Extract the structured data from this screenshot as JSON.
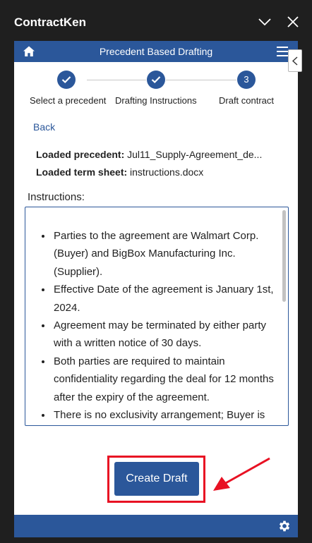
{
  "window": {
    "title": "ContractKen"
  },
  "header": {
    "title": "Precedent Based Drafting"
  },
  "steps": [
    {
      "number": "1",
      "label": "Select a precedent",
      "done": true
    },
    {
      "number": "2",
      "label": "Drafting Instructions",
      "done": true
    },
    {
      "number": "3",
      "label": "Draft contract",
      "done": false
    }
  ],
  "nav": {
    "back_label": "Back"
  },
  "loaded": {
    "precedent_label": "Loaded precedent:",
    "precedent_value": "Jul11_Supply-Agreement_de...",
    "termsheet_label": "Loaded term sheet:",
    "termsheet_value": "instructions.docx"
  },
  "instructions": {
    "label": "Instructions:",
    "items": [
      "Parties to the agreement are Walmart Corp. (Buyer) and BigBox Manufacturing Inc. (Supplier).",
      "Effective Date of the agreement is January 1st, 2024.",
      "Agreement may be terminated by either party with a written notice of 30 days.",
      "Both parties are required to maintain confidentiality regarding the deal for 12 months after the expiry of the agreement.",
      "There is no exclusivity arrangement; Buyer is"
    ]
  },
  "actions": {
    "create_label": "Create Draft"
  },
  "colors": {
    "brand": "#2b579a",
    "highlight": "#e81123",
    "titlebar": "#1f1f1f"
  },
  "icons": {
    "home": "home-icon",
    "menu": "hamburger-menu-icon",
    "settings": "gear-icon",
    "close": "close-icon",
    "minimize": "chevron-down-icon",
    "side": "chevron-left-icon"
  }
}
